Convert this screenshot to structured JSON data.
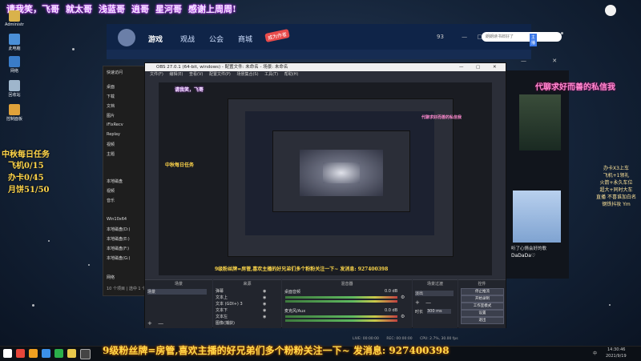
{
  "banner": {
    "items": [
      "请我笑，飞哥",
      "就太哥",
      "浅蓝哥",
      "逍哥",
      "星河哥",
      "感谢上周周!"
    ]
  },
  "desktop": {
    "icons": [
      {
        "name": "Administr",
        "label": "Administr"
      },
      {
        "name": "此电脑",
        "label": "此电脑"
      },
      {
        "name": "网络",
        "label": "网络"
      },
      {
        "name": "回收站",
        "label": "回收站"
      },
      {
        "name": "控制面板",
        "label": "控制面板"
      }
    ],
    "task_title": "中秋每日任务",
    "task_lines": "飞机0/15\n办卡0/45\n月饼51/50"
  },
  "site": {
    "nav": [
      "游戏",
      "观战",
      "公会",
      "商城"
    ],
    "active_nav": "游戏",
    "badge": "成为作者",
    "search_placeholder": "朗朗读书郎好了",
    "login_label": "主播",
    "count": "93"
  },
  "explorer": {
    "items": [
      "快速访问",
      "桌面",
      "下载",
      "文档",
      "图片",
      "iFlxRecv",
      "Replay",
      "视频",
      "视频",
      "主题",
      "音乐",
      "本地磁盘",
      "本地磁盘(D:)",
      "Win10x64",
      "本地磁盘(E:)",
      "本地磁盘(F:)",
      "本地磁盘(G:)",
      "网络"
    ],
    "footer": "10 个项目  |  选中 1 个"
  },
  "obs": {
    "title": "OBS 27.0.1 (64-bit, windows) - 配置文件: 未命名 - 场景: 未命名",
    "menus": [
      "文件(F)",
      "编辑(E)",
      "查看(V)",
      "配置文件(P)",
      "场景集合(S)",
      "工具(T)",
      "帮助(H)"
    ],
    "docks": {
      "scenes": {
        "title": "场景",
        "items": [
          "场景"
        ]
      },
      "sources": {
        "title": "来源",
        "items": [
          "弹幕",
          "文本上",
          "文本 (GDI+) 3",
          "文本下",
          "文本左",
          "图像(捕获)"
        ]
      },
      "mixer": {
        "title": "混音器",
        "channels": [
          {
            "name": "桌面音频",
            "db": "0.0 dB"
          },
          {
            "name": "麦克风/Aux",
            "db": "0.0 dB"
          }
        ]
      },
      "transitions": {
        "title": "场景过渡",
        "type": "淡出",
        "duration_label": "时长",
        "duration": "300 ms"
      },
      "controls": {
        "title": "控件",
        "buttons": [
          "停止推流",
          "开始录制",
          "工作室模式",
          "设置",
          "退出"
        ]
      }
    },
    "status": {
      "live": "LIVE: 00:00:00",
      "rec": "REC: 00:00:00",
      "cpu": "CPU: 2.7%, 30.00 fps"
    }
  },
  "right": {
    "title": "代聊求好而善的私信我",
    "song": "听了心情会好的歌",
    "artist": "DaDaDa♡",
    "notes": "办卡X3上车\n飞机+1领礼\n火箭+永久车位\n超大+同时大车\n直播 不喜谁加白名\n钢铁抖妆 Ym"
  },
  "ticker": {
    "text": "9级粉丝牌=房管,喜欢主播的好兄弟们多个粉粉关注一下~  发消息: 927400398"
  },
  "taskbar": {
    "time": "14:30:46",
    "date": "2021/9/19",
    "lang": "中"
  },
  "colors": {
    "accent_pink": "#d040ff",
    "ticker_yellow": "#ffd84a",
    "obs_bg": "#2b2e38"
  }
}
